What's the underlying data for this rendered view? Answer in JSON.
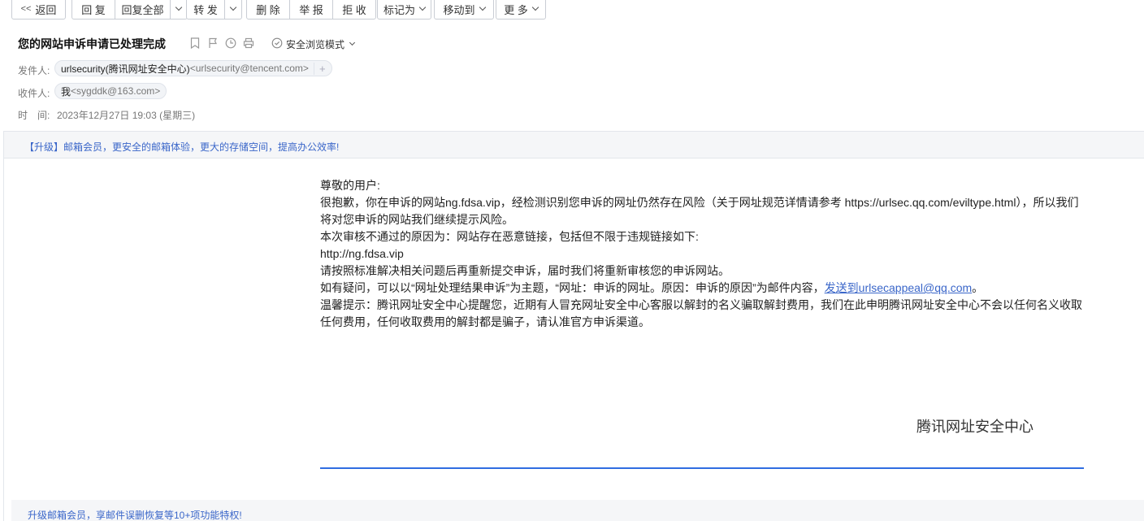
{
  "toolbar": {
    "back_label": "返回",
    "reply_label": "回 复",
    "reply_all_label": "回复全部",
    "forward_label": "转 发",
    "delete_label": "删 除",
    "report_label": "举 报",
    "reject_label": "拒 收",
    "mark_as_label": "标记为",
    "move_to_label": "移动到",
    "more_label": "更 多"
  },
  "header": {
    "subject": "您的网站申诉申请已处理完成",
    "safe_mode_label": "安全浏览模式",
    "sender_label": "发件人:",
    "sender_name": "urlsecurity(腾讯网址安全中心)",
    "sender_address": "<urlsecurity@tencent.com>",
    "recipient_label": "收件人:",
    "recipient_name": "我",
    "recipient_address": "<sygddk@163.com>",
    "time_label": "时　间:",
    "time_value": "2023年12月27日 19:03 (星期三)"
  },
  "promo": {
    "top_text": "【升级】邮箱会员，更安全的邮箱体验，更大的存储空间，提高办公效率!",
    "bottom_text": "升级邮箱会员，享邮件误删恢复等10+项功能特权!"
  },
  "body": {
    "greeting": "尊敬的用户:",
    "line1": "很抱歉，你在申诉的网站ng.fdsa.vip，经检测识别您申诉的网址仍然存在风险（关于网址规范详情请参考 https://urlsec.qq.com/eviltype.html），所以我们将对您申诉的网站我们继续提示风险。",
    "line2": "本次审核不通过的原因为：网站存在恶意链接，包括但不限于违规链接如下:",
    "line3": "http://ng.fdsa.vip",
    "line4": "请按照标准解决相关问题后再重新提交申诉，届时我们将重新审核您的申诉网站。",
    "line5_prefix": "如有疑问，可以以“网址处理结果申诉”为主题，“网址：申诉的网址。原因：申诉的原因”为邮件内容，",
    "line5_link": "发送到urlsecappeal@qq.com",
    "line5_suffix": "。",
    "line6": "温馨提示：腾讯网址安全中心提醒您，近期有人冒充网址安全中心客服以解封的名义骗取解封费用，我们在此申明腾讯网址安全中心不会以任何名义收取任何费用，任何收取费用的解封都是骗子，请认准官方申诉渠道。",
    "signature": "腾讯网址安全中心"
  },
  "colors": {
    "link": "#3a66c9",
    "signature_line": "#2f6de1"
  }
}
